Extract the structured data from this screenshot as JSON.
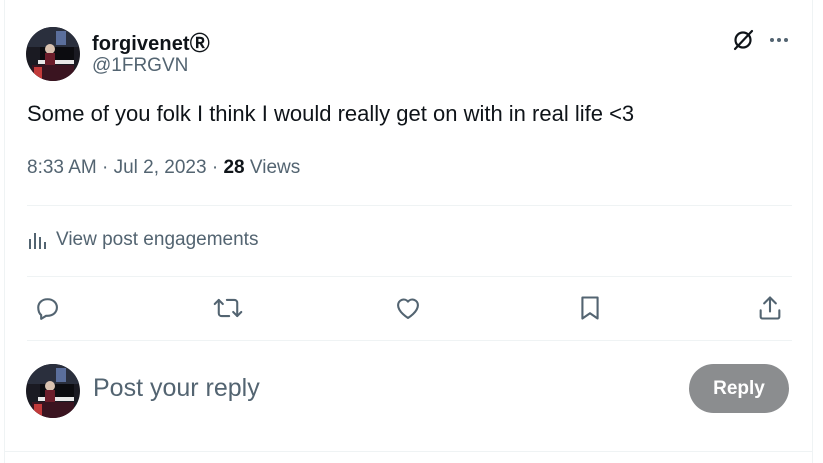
{
  "author": {
    "display_name": "forgivenet",
    "badge": "Ⓡ",
    "handle": "@1FRGVN",
    "avatar_icon": "avatar-pianist-image"
  },
  "header_icons": {
    "grok": "grok-icon",
    "more": "more-dots-icon"
  },
  "post": {
    "text": "Some of you folk I think I would really get on with in real life <3",
    "time": "8:33 AM",
    "date": "Jul 2, 2023",
    "views_count": "28",
    "views_label": "Views"
  },
  "engagements": {
    "label": "View post engagements",
    "icon": "bar-chart-icon"
  },
  "actions": [
    {
      "name": "reply",
      "icon": "reply-bubble-icon"
    },
    {
      "name": "repost",
      "icon": "repost-icon"
    },
    {
      "name": "like",
      "icon": "heart-icon"
    },
    {
      "name": "bookmark",
      "icon": "bookmark-icon"
    },
    {
      "name": "share",
      "icon": "share-icon"
    }
  ],
  "reply_box": {
    "placeholder": "Post your reply",
    "button_label": "Reply"
  },
  "colors": {
    "text_primary": "#0f1419",
    "text_secondary": "#536471",
    "divider": "#eff3f4",
    "reply_button_disabled": "#8b8d8f"
  }
}
